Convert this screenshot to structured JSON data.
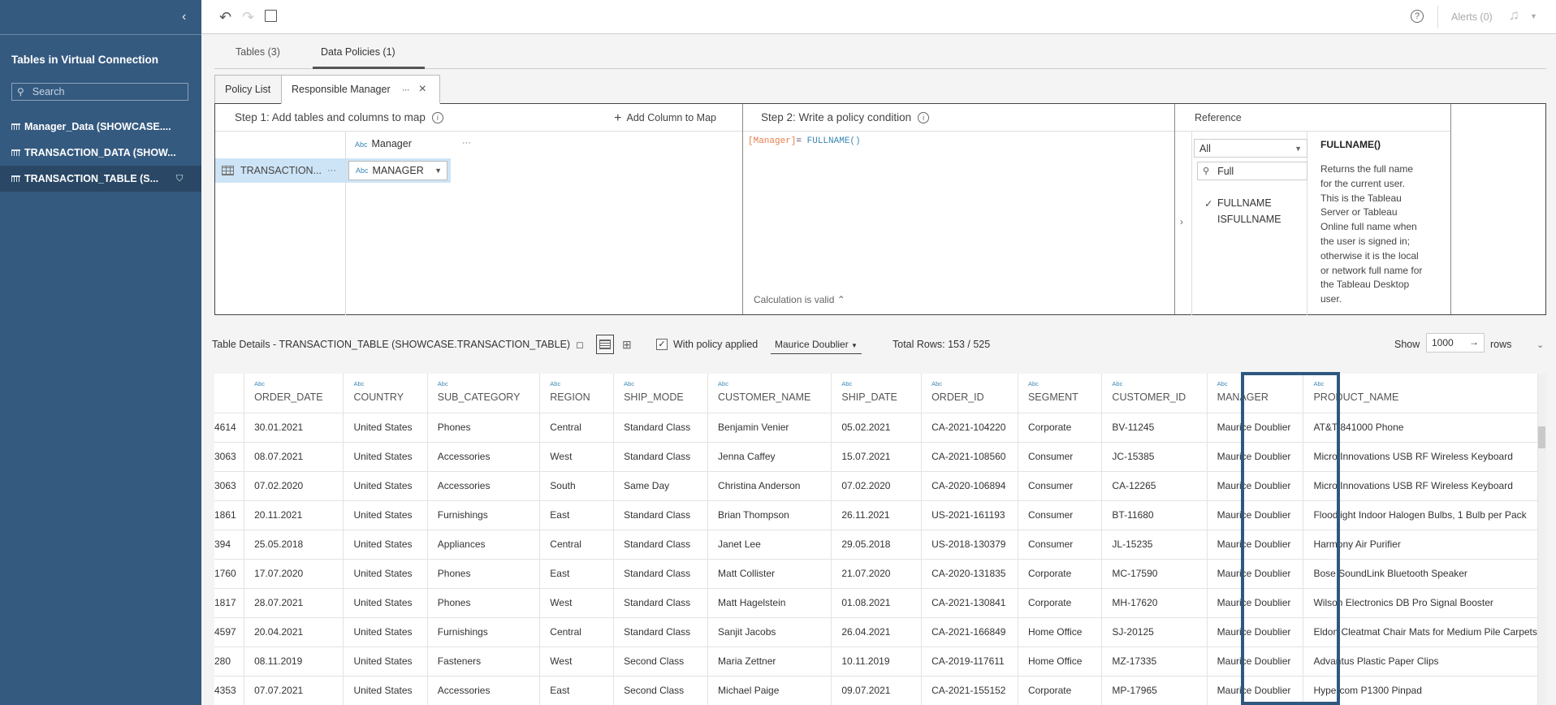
{
  "sidebar": {
    "title": "Tables in Virtual Connection",
    "search_placeholder": "Search",
    "items": [
      {
        "label": "Manager_Data (SHOWCASE...."
      },
      {
        "label": "TRANSACTION_DATA (SHOW..."
      },
      {
        "label": "TRANSACTION_TABLE (S...",
        "active": true
      }
    ],
    "collapse_icon": "‹"
  },
  "topbar": {
    "undo_icon": "↶",
    "redo_icon": "↷",
    "help_icon": "?",
    "alerts_label": "Alerts (0)",
    "bell_icon": "🔔"
  },
  "main_tabs": [
    {
      "label": "Tables (3)"
    },
    {
      "label": "Data Policies (1)",
      "active": true
    }
  ],
  "policy_tabs": {
    "list_label": "Policy List",
    "active_label": "Responsible Manager",
    "dots": "···",
    "close": "×"
  },
  "step1": {
    "title": "Step 1: Add tables and columns to map",
    "add_column_label": "Add Column to Map",
    "column_header": "Manager",
    "row_table": "TRANSACTION...",
    "row_mapping": "MANAGER",
    "abc": "Abc"
  },
  "step2": {
    "title": "Step 2: Write a policy condition",
    "code_field": "[Manager]",
    "code_op": "= ",
    "code_fn": "FULLNAME()",
    "status": "Calculation is valid"
  },
  "reference": {
    "title": "Reference",
    "category": "All",
    "search_value": "Full",
    "items": [
      "FULLNAME",
      "ISFULLNAME"
    ],
    "selected_fn": "FULLNAME()",
    "description": "Returns the full name for the current user. This is the Tableau Server or Tableau Online full name when the user is signed in; otherwise it is the local or network full name for the Tableau Desktop user."
  },
  "details": {
    "title": "Table Details - TRANSACTION_TABLE (SHOWCASE.TRANSACTION_TABLE)",
    "with_policy_label": "With policy applied",
    "with_policy_checked": true,
    "user": "Maurice Doublier",
    "total_rows": "Total Rows: 153 / 525",
    "show_label": "Show",
    "show_value": "1000",
    "rows_label": "rows"
  },
  "table": {
    "type_label": "Abc",
    "columns": [
      "",
      "ORDER_DATE",
      "COUNTRY",
      "SUB_CATEGORY",
      "REGION",
      "SHIP_MODE",
      "CUSTOMER_NAME",
      "SHIP_DATE",
      "ORDER_ID",
      "SEGMENT",
      "CUSTOMER_ID",
      "MANAGER",
      "PRODUCT_NAME"
    ],
    "rows": [
      [
        "4614",
        "30.01.2021",
        "United States",
        "Phones",
        "Central",
        "Standard Class",
        "Benjamin Venier",
        "05.02.2021",
        "CA-2021-104220",
        "Corporate",
        "BV-11245",
        "Maurice Doublier",
        "AT&T 841000 Phone"
      ],
      [
        "3063",
        "08.07.2021",
        "United States",
        "Accessories",
        "West",
        "Standard Class",
        "Jenna Caffey",
        "15.07.2021",
        "CA-2021-108560",
        "Consumer",
        "JC-15385",
        "Maurice Doublier",
        "Micro Innovations USB RF Wireless Keyboard"
      ],
      [
        "3063",
        "07.02.2020",
        "United States",
        "Accessories",
        "South",
        "Same Day",
        "Christina Anderson",
        "07.02.2020",
        "CA-2020-106894",
        "Consumer",
        "CA-12265",
        "Maurice Doublier",
        "Micro Innovations USB RF Wireless Keyboard"
      ],
      [
        "1861",
        "20.11.2021",
        "United States",
        "Furnishings",
        "East",
        "Standard Class",
        "Brian Thompson",
        "26.11.2021",
        "US-2021-161193",
        "Consumer",
        "BT-11680",
        "Maurice Doublier",
        "Floodlight Indoor Halogen Bulbs, 1 Bulb per Pack"
      ],
      [
        "394",
        "25.05.2018",
        "United States",
        "Appliances",
        "Central",
        "Standard Class",
        "Janet Lee",
        "29.05.2018",
        "US-2018-130379",
        "Consumer",
        "JL-15235",
        "Maurice Doublier",
        "Harmony Air Purifier"
      ],
      [
        "1760",
        "17.07.2020",
        "United States",
        "Phones",
        "East",
        "Standard Class",
        "Matt Collister",
        "21.07.2020",
        "CA-2020-131835",
        "Corporate",
        "MC-17590",
        "Maurice Doublier",
        "Bose SoundLink Bluetooth Speaker"
      ],
      [
        "1817",
        "28.07.2021",
        "United States",
        "Phones",
        "West",
        "Standard Class",
        "Matt Hagelstein",
        "01.08.2021",
        "CA-2021-130841",
        "Corporate",
        "MH-17620",
        "Maurice Doublier",
        "Wilson Electronics DB Pro Signal Booster"
      ],
      [
        "4597",
        "20.04.2021",
        "United States",
        "Furnishings",
        "Central",
        "Standard Class",
        "Sanjit Jacobs",
        "26.04.2021",
        "CA-2021-166849",
        "Home Office",
        "SJ-20125",
        "Maurice Doublier",
        "Eldon Cleatmat Chair Mats for Medium Pile Carpets"
      ],
      [
        "280",
        "08.11.2019",
        "United States",
        "Fasteners",
        "West",
        "Second Class",
        "Maria Zettner",
        "10.11.2019",
        "CA-2019-117611",
        "Home Office",
        "MZ-17335",
        "Maurice Doublier",
        "Advantus Plastic Paper Clips"
      ],
      [
        "4353",
        "07.07.2021",
        "United States",
        "Accessories",
        "East",
        "Second Class",
        "Michael Paige",
        "09.07.2021",
        "CA-2021-155152",
        "Corporate",
        "MP-17965",
        "Maurice Doublier",
        "Hypercom P1300 Pinpad"
      ]
    ]
  },
  "colors": {
    "sidebar_bg": "#355a80",
    "highlight_border": "#2f5880",
    "selected_row": "#cde4f6",
    "field_color": "#e67e4b",
    "function_color": "#3a86b4"
  }
}
